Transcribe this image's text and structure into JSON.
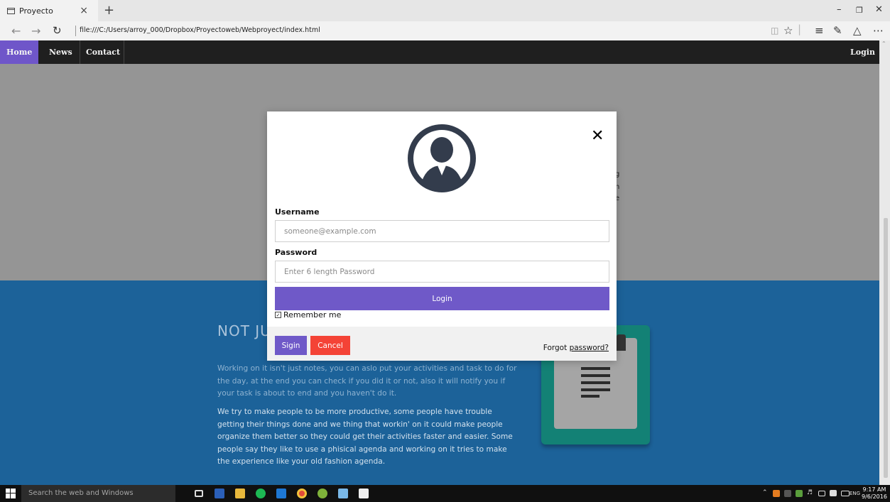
{
  "browser": {
    "tab_title": "Proyecto",
    "tab_close": "×",
    "new_tab": "+",
    "url": "file:///C:/Users/arroy_000/Dropbox/Proyectoweb/Webproyect/index.html"
  },
  "site_nav": {
    "items": [
      "Home",
      "News",
      "Contact"
    ],
    "login": "Login"
  },
  "hero_fragments": [
    "g",
    "n",
    "e"
  ],
  "section": {
    "heading": "NOT JU",
    "paragraph1": "Working on it isn't just notes, you can aslo put your activities and task to do for the day, at the end you can check if you did it or not, also it will notify you if your task is about to end and you haven't do it.",
    "paragraph2": "We try to make people to be more productive, some people have trouble getting their things done and we thing that workin' on it could make people organize them better so they could get their activities faster and easier. Some people say they like to use a phisical agenda and working on it tries to make the experience like your old fashion agenda."
  },
  "modal": {
    "close": "✕",
    "username_label": "Username",
    "username_placeholder": "someone@example.com",
    "password_label": "Password",
    "password_placeholder": "Enter 6 length Password",
    "login_button": "Login",
    "remember_label": "Remember me",
    "sign_button": "Sigin",
    "cancel_button": "Cancel",
    "forgot_prefix": "Forgot ",
    "forgot_link": "password?"
  },
  "taskbar": {
    "search_placeholder": "Search the web and Windows",
    "language": "ENG",
    "time": "9:17 AM",
    "date": "9/6/2016"
  },
  "colors": {
    "accent": "#6f59c8",
    "cancel": "#f44336",
    "section_blue": "#1c6299",
    "hero_gray": "#959595"
  }
}
